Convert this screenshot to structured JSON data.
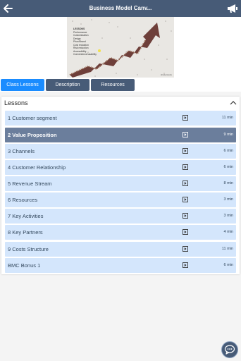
{
  "header": {
    "title": "Business Model Canv...",
    "back_icon": "arrow-left-icon",
    "announcement_icon": "megaphone-icon"
  },
  "hero": {
    "list_title": "LESSONS",
    "list_items": [
      "Performance",
      "Customization",
      "Design",
      "Price/Brand",
      "Cost reduction",
      "Risk reduction",
      "Accessibility",
      "Convenience/usability"
    ],
    "credit": "shutterstock"
  },
  "tabs": [
    {
      "label": "Class Lessons",
      "active": true
    },
    {
      "label": "Description",
      "active": false
    },
    {
      "label": "Resources",
      "active": false
    }
  ],
  "lessons_panel": {
    "title": "Lessons",
    "collapse_icon": "chevron-up-icon",
    "items": [
      {
        "label": "1 Customer segment",
        "duration": "11 min",
        "active": false
      },
      {
        "label": "2 Value Proposition",
        "duration": "9 min",
        "active": true
      },
      {
        "label": "3 Channels",
        "duration": "6 min",
        "active": false
      },
      {
        "label": "4 Customer Relationship",
        "duration": "6 min",
        "active": false
      },
      {
        "label": "5 Revenue Stream",
        "duration": "8 min",
        "active": false
      },
      {
        "label": "6 Resources",
        "duration": "3 min",
        "active": false
      },
      {
        "label": "7 Key Activities",
        "duration": "3 min",
        "active": false
      },
      {
        "label": "8 Key Partners",
        "duration": "4 min",
        "active": false
      },
      {
        "label": "9 Costs Structure",
        "duration": "11 min",
        "active": false
      },
      {
        "label": "BMC Bonus 1",
        "duration": "6 min",
        "active": false
      }
    ]
  },
  "chat_icon": "chat-bubble-icon",
  "colors": {
    "header_bg": "#475b77",
    "tab_active": "#1a8cff",
    "lesson_bg": "#d4e6fc",
    "lesson_active_bg": "#6b7e9c"
  }
}
